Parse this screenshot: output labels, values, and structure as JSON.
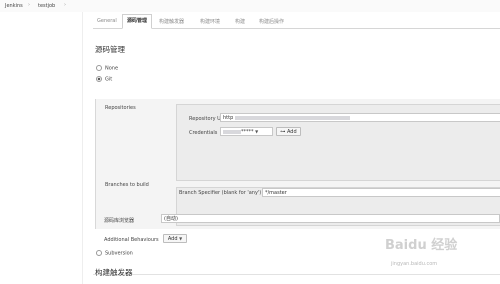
{
  "breadcrumb": {
    "items": [
      "Jenkins",
      "testjob"
    ],
    "sep": "›"
  },
  "tabs": [
    {
      "label": "General",
      "active": false
    },
    {
      "label": "源码管理",
      "active": true
    },
    {
      "label": "构建触发器",
      "active": false
    },
    {
      "label": "构建环境",
      "active": false
    },
    {
      "label": "构建",
      "active": false
    },
    {
      "label": "构建后操作",
      "active": false
    }
  ],
  "scm": {
    "title": "源码管理",
    "none_label": "None",
    "git_label": "Git",
    "repositories_label": "Repositories",
    "repo_url_label": "Repository URL",
    "repo_url_value": "http",
    "credentials_label": "Credentials",
    "credentials_value": "*****",
    "add_label": "Add",
    "branches_label": "Branches to build",
    "branch_specifier_label": "Branch Specifier (blank for 'any')",
    "branch_specifier_value": "*/master",
    "browser_label": "源码库浏览器",
    "browser_value": "(自动)",
    "additional_label": "Additional Behaviours",
    "additional_add_label": "Add",
    "subversion_label": "Subversion"
  },
  "trigger_title": "构建触发器",
  "watermark": {
    "brand": "Baidu 经验",
    "url": "jingyan.baidu.com"
  },
  "colors": {
    "panel": "#f4f4f4",
    "border": "#d5d5d5",
    "text": "#333333"
  }
}
